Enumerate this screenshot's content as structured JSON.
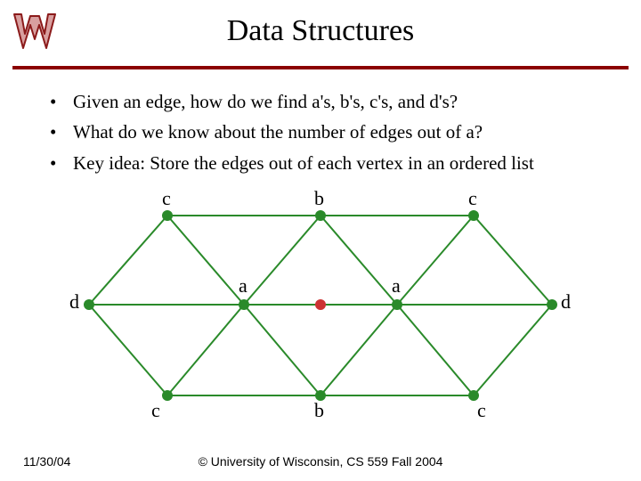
{
  "title": "Data Structures",
  "bullets": [
    "Given an edge, how do we find a's, b's, c's, and d's?",
    "What do we know about the number of edges out of a?",
    "Key idea: Store the edges out of each vertex in an ordered list"
  ],
  "footer": {
    "date": "11/30/04",
    "copyright": "© University of Wisconsin, CS 559 Fall 2004"
  },
  "diagram": {
    "labels": {
      "top_c_left": "c",
      "top_b": "b",
      "top_c_right": "c",
      "mid_d_left": "d",
      "mid_a_left": "a",
      "mid_a_right": "a",
      "mid_d_right": "d",
      "bot_c_left": "c",
      "bot_b": "b",
      "bot_c_right": "c"
    }
  },
  "colors": {
    "edge": "#2a8a2a",
    "vertex": "#2a8a2a",
    "center_vertex": "#cc3333",
    "rule": "#8b0000"
  }
}
